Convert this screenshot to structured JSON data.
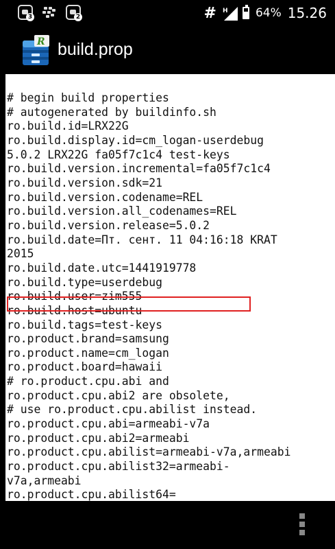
{
  "status_bar": {
    "notif1_count": "3",
    "notif2_count": "2",
    "network_symbol": "#",
    "signal_type": "H",
    "battery_level": 0.64,
    "battery_text": "64%",
    "time": "15.26"
  },
  "app_bar": {
    "title": "build.prop",
    "icon": "root-explorer-icon"
  },
  "file_lines": [
    "# begin build properties",
    "# autogenerated by buildinfo.sh",
    "ro.build.id=LRX22G",
    "ro.build.display.id=cm_logan-userdebug",
    "5.0.2 LRX22G fa05f7c1c4 test-keys",
    "ro.build.version.incremental=fa05f7c1c4",
    "ro.build.version.sdk=21",
    "ro.build.version.codename=REL",
    "ro.build.version.all_codenames=REL",
    "ro.build.version.release=5.0.2",
    "ro.build.date=Пт. сент. 11 04:16:18 KRAT",
    "2015",
    "ro.build.date.utc=1441919778",
    "ro.build.type=userdebug",
    "ro.build.user=zim555",
    "ro.build.host=ubuntu",
    "ro.build.tags=test-keys",
    "ro.product.brand=samsung",
    "ro.product.name=cm_logan",
    "ro.product.board=hawaii",
    "# ro.product.cpu.abi and",
    "ro.product.cpu.abi2 are obsolete,",
    "# use ro.product.cpu.abilist instead.",
    "ro.product.cpu.abi=armeabi-v7a",
    "ro.product.cpu.abi2=armeabi",
    "ro.product.cpu.abilist=armeabi-v7a,armeabi",
    "ro.product.cpu.abilist32=armeabi-",
    "v7a,armeabi",
    "ro.product.cpu.abilist64="
  ],
  "highlighted_line_index": 9,
  "colors": {
    "highlight": "#e02020",
    "background": "#ffffff",
    "bars": "#000000"
  },
  "navbar": {
    "menu_icon": "overflow-menu-icon"
  }
}
